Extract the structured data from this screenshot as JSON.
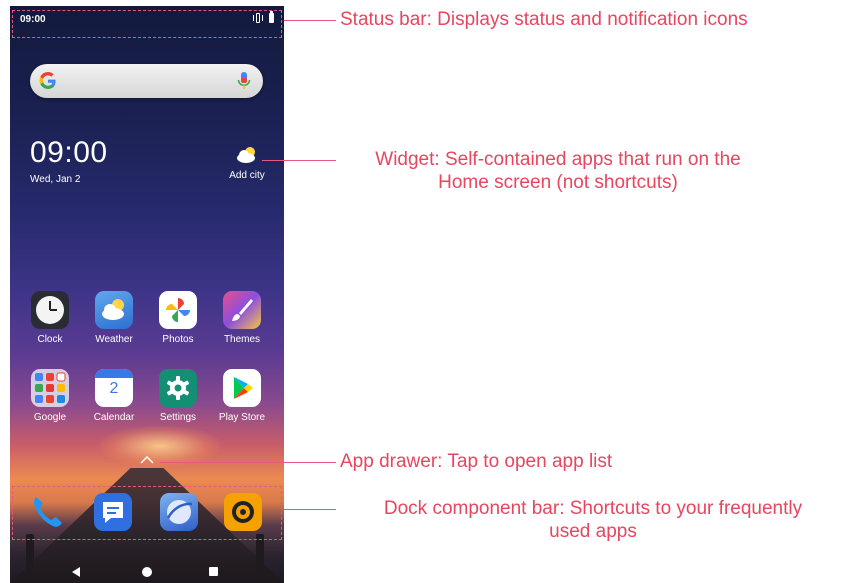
{
  "status_bar": {
    "time": "09:00"
  },
  "search": {
    "provider": "G"
  },
  "clock_widget": {
    "time": "09:00",
    "date": "Wed, Jan 2"
  },
  "weather_widget": {
    "label": "Add city"
  },
  "apps_row1": [
    {
      "label": "Clock",
      "icon": "clock-icon"
    },
    {
      "label": "Weather",
      "icon": "weather-icon"
    },
    {
      "label": "Photos",
      "icon": "photos-icon"
    },
    {
      "label": "Themes",
      "icon": "themes-icon"
    }
  ],
  "apps_row2": [
    {
      "label": "Google",
      "icon": "google-folder-icon"
    },
    {
      "label": "Calendar",
      "icon": "calendar-icon",
      "date_number": "2"
    },
    {
      "label": "Settings",
      "icon": "settings-icon"
    },
    {
      "label": "Play Store",
      "icon": "play-store-icon"
    }
  ],
  "dock": [
    {
      "icon": "phone-icon",
      "color": "#2196f3"
    },
    {
      "icon": "messages-icon",
      "color": "#2f6fe0"
    },
    {
      "icon": "browser-icon",
      "color": "#4a7fe0"
    },
    {
      "icon": "camera-icon",
      "color": "#f5a100"
    }
  ],
  "annotations": {
    "status_bar": "Status bar: Displays status and notification icons",
    "widget_line1": "Widget: Self-contained apps that run on the",
    "widget_line2": "Home screen (not shortcuts)",
    "app_drawer": "App drawer: Tap to open app list",
    "dock_line1": "Dock component bar: Shortcuts to your frequently",
    "dock_line2": "used apps"
  },
  "colors": {
    "annotation": "#e8455f",
    "wallpaper_top": "#131a3d",
    "sunset": "#ec8a52"
  }
}
